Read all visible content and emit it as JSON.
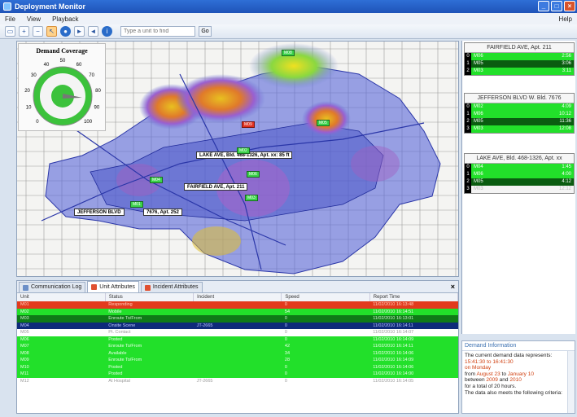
{
  "window": {
    "title": "Deployment Monitor"
  },
  "menu": {
    "items": [
      "File",
      "View",
      "Playback"
    ],
    "help": "Help"
  },
  "toolbar": {
    "search_placeholder": "Type a unit to find",
    "search_go": "Go"
  },
  "gauge": {
    "title": "Demand Coverage",
    "ticks": [
      "0",
      "10",
      "20",
      "30",
      "40",
      "50",
      "60",
      "70",
      "80",
      "90",
      "100"
    ],
    "value": 85
  },
  "map": {
    "labels": [
      "LAKE AVE, Bld. 468-1326, Apt. xx: 85 ft",
      "FAIRFIELD AVE, Apt. 211",
      "JEFFERSON BLVD",
      "7676, Apt. 252"
    ],
    "unit_tags": [
      "M05",
      "M02",
      "M04",
      "M06",
      "M03",
      "M01",
      "M08",
      "M07"
    ],
    "red_tag": "M09"
  },
  "incidents": [
    {
      "header": "FAIRFIELD AVE, Apt. 211",
      "rows": [
        {
          "num": "0",
          "unit": "M06",
          "value": "2:56",
          "style": "green"
        },
        {
          "num": "1",
          "unit": "M05",
          "value": "3:06",
          "style": "dark"
        },
        {
          "num": "2",
          "unit": "M03",
          "value": "3:11",
          "style": "green"
        }
      ]
    },
    {
      "header": "JEFFERSON BLVD W. Bld. 7676",
      "rows": [
        {
          "num": "0",
          "unit": "M02",
          "value": "4:09",
          "style": "green"
        },
        {
          "num": "1",
          "unit": "M06",
          "value": "10:12",
          "style": "green"
        },
        {
          "num": "2",
          "unit": "M05",
          "value": "11:36",
          "style": "dark"
        },
        {
          "num": "3",
          "unit": "M03",
          "value": "12:08",
          "style": "green"
        }
      ]
    },
    {
      "header": "LAKE AVE, Bld. 468-1326, Apt. xx",
      "rows": [
        {
          "num": "0",
          "unit": "M04",
          "value": "1:45",
          "style": "green"
        },
        {
          "num": "1",
          "unit": "M06",
          "value": "4:00",
          "style": "green"
        },
        {
          "num": "2",
          "unit": "M05",
          "value": "4:12",
          "style": "dark"
        },
        {
          "num": "3",
          "unit": "M03",
          "value": "12:12",
          "style": "white"
        }
      ]
    }
  ],
  "bottom": {
    "tabs": [
      "Communication Log",
      "Unit Attributes",
      "Incident Attributes"
    ],
    "columns": [
      "Unit",
      "Status",
      "Incident",
      "Speed",
      "Report Time"
    ],
    "rows": [
      {
        "cells": [
          "M01",
          "Responding",
          "",
          "0",
          "11/02/2010 16:13:48"
        ],
        "style": "r-red"
      },
      {
        "cells": [
          "M02",
          "Mobile",
          "",
          "54",
          "11/02/2010 16:14:51"
        ],
        "style": "r-green"
      },
      {
        "cells": [
          "M03",
          "Enroute To/From",
          "",
          "0",
          "11/02/2010 16:13:01"
        ],
        "style": "r-dgreen"
      },
      {
        "cells": [
          "M04",
          "Onsite Scene",
          "JT-2665",
          "0",
          "11/02/2010 16:14:11"
        ],
        "style": "r-navy"
      },
      {
        "cells": [
          "M05",
          "Pt. Contact",
          "",
          "0",
          "11/02/2010 16:14:07"
        ],
        "style": "r-white"
      },
      {
        "cells": [
          "M06",
          "Posted",
          "",
          "0",
          "11/02/2010 16:14:09"
        ],
        "style": "r-green"
      },
      {
        "cells": [
          "M07",
          "Enroute To/From",
          "",
          "42",
          "11/02/2010 16:14:11"
        ],
        "style": "r-green"
      },
      {
        "cells": [
          "M08",
          "Available",
          "",
          "34",
          "11/02/2010 16:14:06"
        ],
        "style": "r-green"
      },
      {
        "cells": [
          "M09",
          "Enroute To/From",
          "",
          "28",
          "11/02/2010 16:14:09"
        ],
        "style": "r-green"
      },
      {
        "cells": [
          "M10",
          "Posted",
          "",
          "0",
          "11/02/2010 16:14:06"
        ],
        "style": "r-green"
      },
      {
        "cells": [
          "M11",
          "Posted",
          "",
          "0",
          "11/02/2010 16:14:00"
        ],
        "style": "r-green"
      },
      {
        "cells": [
          "M12",
          "At Hospital",
          "JT-2665",
          "0",
          "11/02/2010 16:14:05"
        ],
        "style": "r-white"
      }
    ]
  },
  "demand_info": {
    "title": "Demand Information",
    "line1": "The current demand data represents:",
    "time_range": "15:41:30 to 16:41:30",
    "day": "on Monday",
    "from_label": "from",
    "from_date": "August 23",
    "to_label": "to",
    "to_date": "January 10",
    "between_label": "between",
    "year1": "2009",
    "and_label": "and",
    "year2": "2010",
    "total": "for a total of 20 hours.",
    "criteria": "The data also meets the following criteria:"
  }
}
